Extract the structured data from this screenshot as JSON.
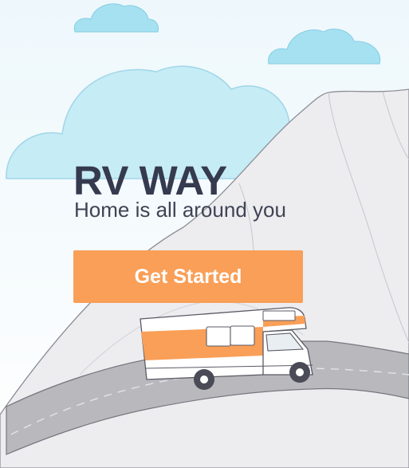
{
  "brand": {
    "title": "RV WAY",
    "tagline": "Home is all around you"
  },
  "cta": {
    "label": "Get Started"
  },
  "colors": {
    "accent": "#f99f57",
    "title_text": "#363a4f",
    "sky_cloud": "#a6e1f2",
    "mountain": "#ececf0",
    "road": "#b8b8bd"
  },
  "illustration": {
    "icons": [
      "cloud-icon",
      "mountain-icon",
      "road-icon",
      "rv-camper-icon"
    ]
  }
}
